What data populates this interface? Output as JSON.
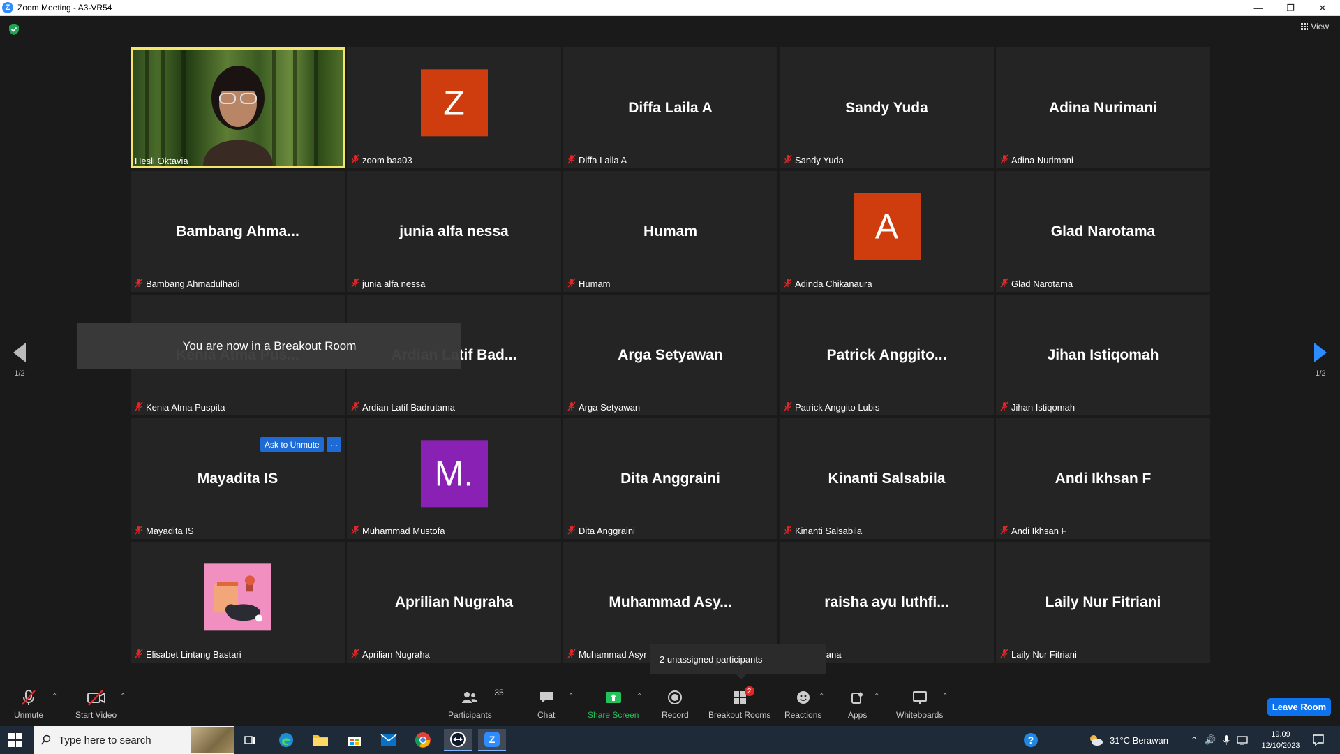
{
  "window": {
    "title": "Zoom Meeting - A3-VR54"
  },
  "header": {
    "view_label": "View"
  },
  "tiles": [
    {
      "tile_name": "Hesli Oktavia",
      "label": "Hesli Oktavia",
      "type": "video"
    },
    {
      "tile_name": "zoom baa03",
      "label": "zoom baa03",
      "type": "avatar",
      "avatar_letter": "Z",
      "avatar_color": "#cf3d0f"
    },
    {
      "tile_name": "Diffa Laila A",
      "label": "Diffa Laila A",
      "type": "name"
    },
    {
      "tile_name": "Sandy Yuda",
      "label": "Sandy Yuda",
      "type": "name"
    },
    {
      "tile_name": "Adina Nurimani",
      "label": "Adina Nurimani",
      "type": "name"
    },
    {
      "tile_name": "Bambang  Ahma...",
      "label": "Bambang Ahmadulhadi",
      "type": "name"
    },
    {
      "tile_name": "junia alfa nessa",
      "label": "junia alfa nessa",
      "type": "name"
    },
    {
      "tile_name": "Humam",
      "label": "Humam",
      "type": "name"
    },
    {
      "tile_name": "Adinda Chikanaura",
      "label": "Adinda Chikanaura",
      "type": "avatar",
      "avatar_letter": "A",
      "avatar_color": "#cf3d0f"
    },
    {
      "tile_name": "Glad Narotama",
      "label": "Glad Narotama",
      "type": "name"
    },
    {
      "tile_name": "Kenia Atma Pus...",
      "label": "Kenia Atma Puspita",
      "type": "name"
    },
    {
      "tile_name": "Ardian Latif Bad...",
      "label": "Ardian Latif Badrutama",
      "type": "name"
    },
    {
      "tile_name": "Arga Setyawan",
      "label": "Arga Setyawan",
      "type": "name"
    },
    {
      "tile_name": "Patrick  Anggito...",
      "label": "Patrick Anggito Lubis",
      "type": "name"
    },
    {
      "tile_name": "Jihan Istiqomah",
      "label": "Jihan Istiqomah",
      "type": "name"
    },
    {
      "tile_name": "Mayadita IS",
      "label": "Mayadita IS",
      "type": "name"
    },
    {
      "tile_name": "Muhammad Mustofa",
      "label": "Muhammad Mustofa",
      "type": "avatar",
      "avatar_letter": "M.",
      "avatar_color": "#8a21b5"
    },
    {
      "tile_name": "Dita Anggraini",
      "label": "Dita Anggraini",
      "type": "name"
    },
    {
      "tile_name": "Kinanti Salsabila",
      "label": "Kinanti Salsabila",
      "type": "name"
    },
    {
      "tile_name": "Andi Ikhsan F",
      "label": "Andi Ikhsan F",
      "type": "name"
    },
    {
      "tile_name": "Elisabet Lintang Bastari",
      "label": "Elisabet Lintang Bastari",
      "type": "picture"
    },
    {
      "tile_name": "Aprilian Nugraha",
      "label": "Aprilian Nugraha",
      "type": "name"
    },
    {
      "tile_name": "Muhammad  Asy...",
      "label": "Muhammad Asyr",
      "type": "name"
    },
    {
      "tile_name": "raisha  ayu  luthfi...",
      "label": "yu luthfiana",
      "type": "name"
    },
    {
      "tile_name": "Laily Nur Fitriani",
      "label": "Laily Nur Fitriani",
      "type": "name"
    }
  ],
  "overlays": {
    "breakout_toast": "You are now in a Breakout Room",
    "ask_to_unmute": "Ask to Unmute",
    "more": "···",
    "unassigned": "2 unassigned participants"
  },
  "pager": {
    "left": "1/2",
    "right": "1/2"
  },
  "toolbar": {
    "unmute": "Unmute",
    "start_video": "Start Video",
    "participants": "Participants",
    "participants_count": "35",
    "chat": "Chat",
    "share_screen": "Share Screen",
    "record": "Record",
    "breakout_rooms": "Breakout Rooms",
    "breakout_badge": "2",
    "reactions": "Reactions",
    "apps": "Apps",
    "whiteboards": "Whiteboards",
    "leave_room": "Leave Room"
  },
  "taskbar": {
    "search_placeholder": "Type here to search",
    "weather": "31°C  Berawan",
    "time": "19.09",
    "date": "12/10/2023"
  },
  "colors": {
    "accent_blue": "#2d8cff",
    "active_speaker_border": "#f4e56a",
    "muted_red": "#e02828"
  }
}
